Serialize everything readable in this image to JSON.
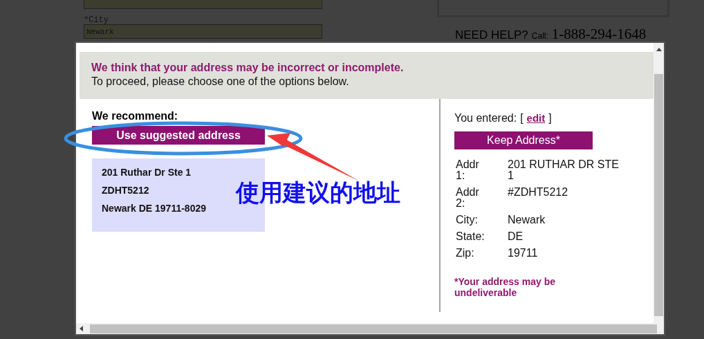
{
  "background": {
    "fields": [
      {
        "label": "*City",
        "value": "Newark"
      }
    ],
    "help": {
      "heading": "NEED HELP?",
      "call_label": "Call:",
      "phone": "1-888-294-1648"
    }
  },
  "dialog": {
    "alert": {
      "title": "We think that your address may be incorrect or incomplete.",
      "message": "To proceed, please choose one of the options below."
    },
    "recommend": {
      "heading": "We recommend:",
      "button": "Use suggested address",
      "address_lines": [
        "201 Ruthar Dr Ste 1",
        "ZDHT5212",
        "Newark DE 19711-8029"
      ]
    },
    "entered": {
      "label": "You entered:",
      "open_bracket": "[",
      "link": "edit",
      "close_bracket": "]",
      "button": "Keep Address*",
      "fields": [
        {
          "label": "Addr 1:",
          "value": "201 RUTHAR DR STE 1"
        },
        {
          "label": "Addr 2:",
          "value": "#ZDHT5212"
        },
        {
          "label": "City:",
          "value": "Newark"
        },
        {
          "label": "State:",
          "value": "DE"
        },
        {
          "label": "Zip:",
          "value": "19711"
        }
      ],
      "warning": "*Your address may be undeliverable"
    }
  },
  "annotation": {
    "text": "使用建议的地址"
  }
}
